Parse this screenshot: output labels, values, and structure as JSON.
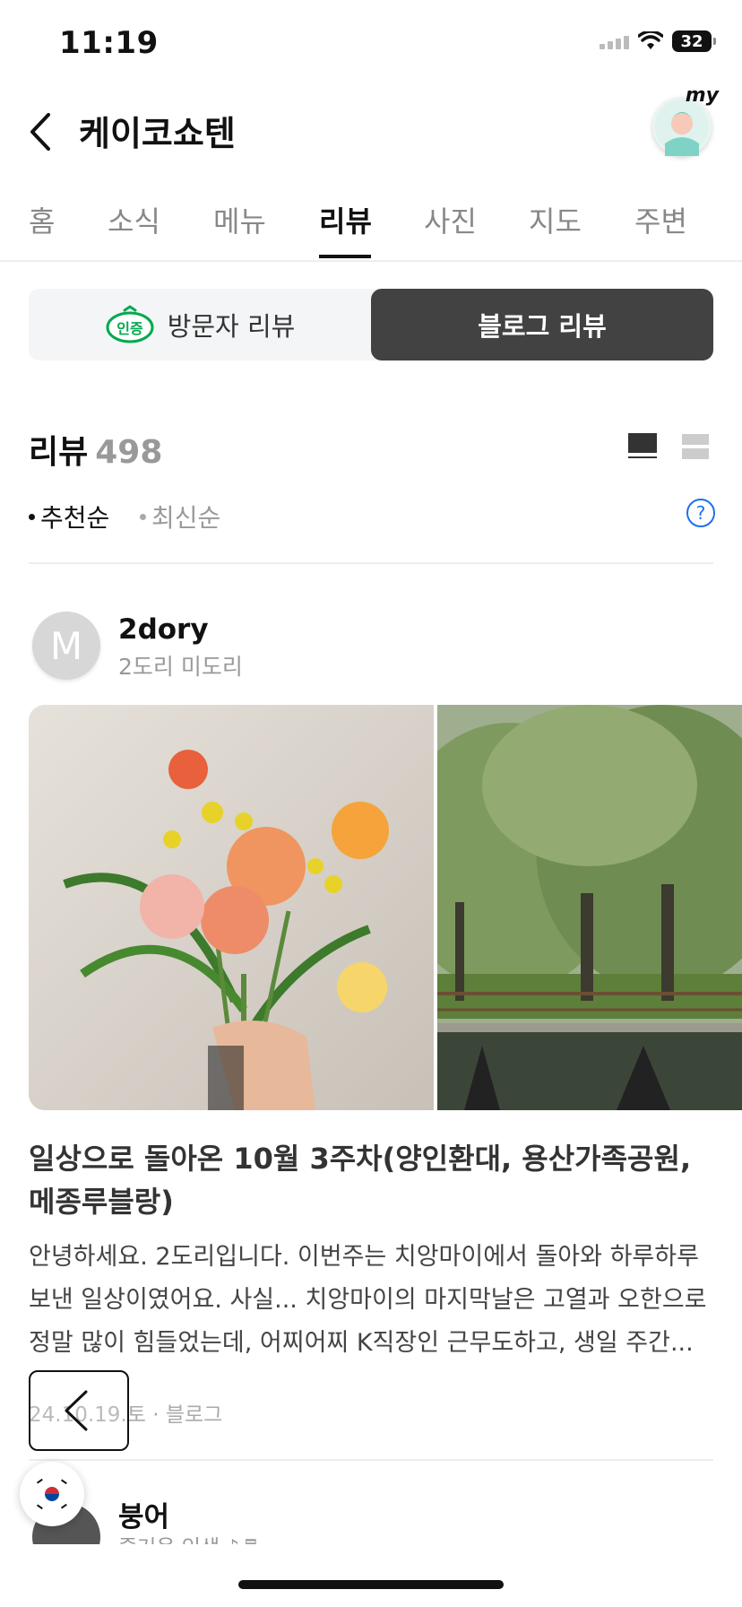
{
  "status": {
    "time": "11:19",
    "battery": "32"
  },
  "header": {
    "title": "케이코쇼텐",
    "my_label": "my"
  },
  "tabs": [
    {
      "label": "홈",
      "active": false
    },
    {
      "label": "소식",
      "active": false
    },
    {
      "label": "메뉴",
      "active": false
    },
    {
      "label": "리뷰",
      "active": true
    },
    {
      "label": "사진",
      "active": false
    },
    {
      "label": "지도",
      "active": false
    },
    {
      "label": "주변",
      "active": false
    }
  ],
  "segments": {
    "visitor": "방문자 리뷰",
    "visitor_badge": "인증",
    "blog": "블로그 리뷰"
  },
  "reviews": {
    "title": "리뷰",
    "count": "498"
  },
  "sort": {
    "recommended": "추천순",
    "latest": "최신순"
  },
  "post": {
    "author_initial": "M",
    "author_name": "2dory",
    "author_sub": "2도리 미도리",
    "title": "일상으로 돌아온 10월 3주차(양인환대, 용산가족공원, 메종루블랑)",
    "body": "안녕하세요. 2도리입니다. 이번주는 치앙마이에서 돌아와 하루하루 보낸 일상이였어요. 사실... 치앙마이의 마지막날은 고열과 오한으로 정말 많이 힘들었는데, 어찌어찌 K직장인 근무도하고, 생일 주간...",
    "meta": "24.10.19.토 · 블로그"
  },
  "next_post": {
    "author_name": "붕어",
    "author_sub": "즐거운 인생 ♪♬"
  },
  "colors": {
    "accent_blue": "#1f6feb",
    "segment_dark": "#424242",
    "badge_green": "#03a94d"
  },
  "icons": [
    "back-arrow-icon",
    "wifi-icon",
    "battery-icon",
    "verified-badge-icon",
    "feed-view-icon",
    "list-view-icon",
    "help-icon",
    "korea-flag-icon"
  ]
}
